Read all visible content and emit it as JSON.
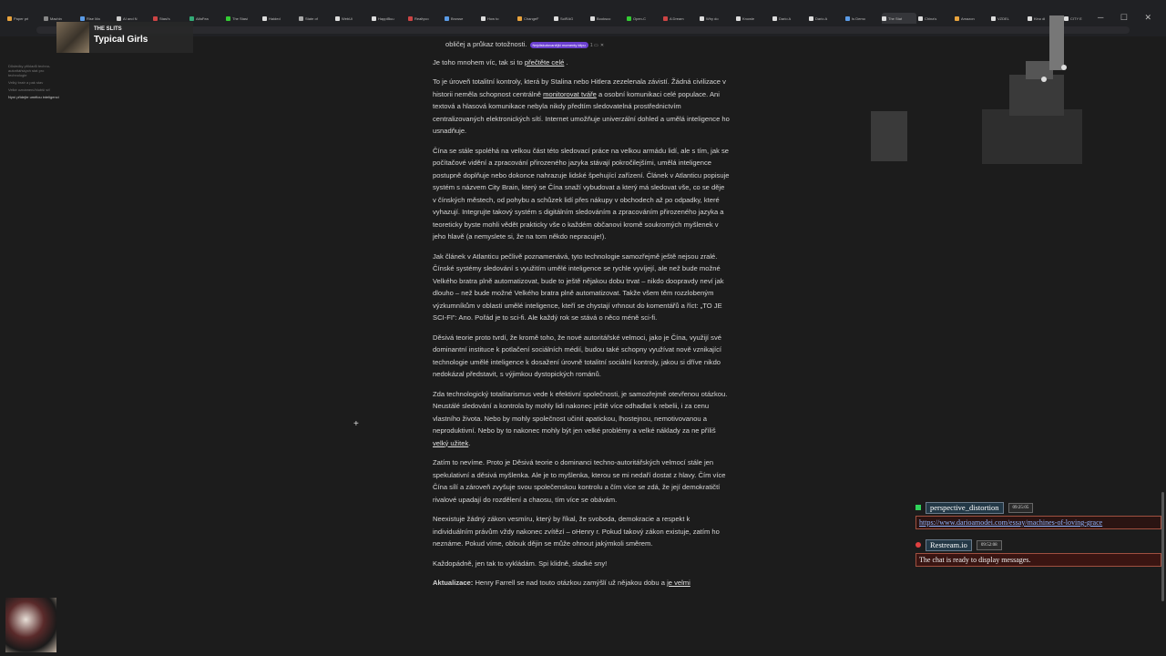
{
  "tabs": [
    {
      "label": "Paper pri",
      "color": "#e8a33d"
    },
    {
      "label": "Machin",
      "color": "#888"
    },
    {
      "label": "Rise Ma",
      "color": "#5a9be6"
    },
    {
      "label": "AI and N",
      "color": "#ccc"
    },
    {
      "label": "Stasi's ",
      "color": "#c44"
    },
    {
      "label": "AlfaFea",
      "color": "#3a7"
    },
    {
      "label": "The Stasi",
      "color": "#3c3"
    },
    {
      "label": "Haided ",
      "color": "#ddd"
    },
    {
      "label": "State of ",
      "color": "#aaa"
    },
    {
      "label": "WebUi",
      "color": "#ddd"
    },
    {
      "label": "HappiBuu",
      "color": "#ddd"
    },
    {
      "label": "Realtyvo",
      "color": "#c44"
    },
    {
      "label": "Browse",
      "color": "#5a9be6"
    },
    {
      "label": "How to ",
      "color": "#ddd"
    },
    {
      "label": "ChangeF",
      "color": "#e8a33d"
    },
    {
      "label": "SciRAG",
      "color": "#ddd"
    },
    {
      "label": "Booksco",
      "color": "#ddd"
    },
    {
      "label": "Open-C",
      "color": "#3c3"
    },
    {
      "label": "A Dream",
      "color": "#c44"
    },
    {
      "label": "Why do",
      "color": "#ddd"
    },
    {
      "label": "Knowle",
      "color": "#ddd"
    },
    {
      "label": "Dario A",
      "color": "#ddd"
    },
    {
      "label": "Dario A",
      "color": "#ddd"
    },
    {
      "label": "Is Demo",
      "color": "#5a9be6"
    },
    {
      "label": "The Stat",
      "color": "#ddd"
    },
    {
      "label": "China's",
      "color": "#ddd"
    },
    {
      "label": "Amazon",
      "color": "#e8a33d"
    },
    {
      "label": "VZDEL",
      "color": "#ddd"
    },
    {
      "label": "Kino di",
      "color": "#ddd"
    },
    {
      "label": "CITY E",
      "color": "#ddd"
    }
  ],
  "player": {
    "artist": "THE SLITS",
    "song": "Typical Girls"
  },
  "toc": [
    {
      "label": "Důsledky příkladů techno-autoritářských stat pro technologie"
    },
    {
      "label": "Velký bratr a pak stav"
    },
    {
      "label": "Velké oznámení/hlubší síť"
    },
    {
      "label": "Nyní přidejte umělou inteligenci"
    }
  ],
  "article": {
    "line0": "obličej a průkaz totožnosti.",
    "pill": "Nejdiskutovanější momenty klipu",
    "p1_pre": "Je toho mnohem víc, tak si to ",
    "p1_link": "přečtěte celé",
    "p1_post": " .",
    "p2_pre": "To je úroveň totalitní kontroly, která by Stalina nebo Hitlera zezelenala závistí. Žádná civilizace v historii neměla schopnost centrálně ",
    "p2_link": "monitorovat tváře",
    "p2_post": " a osobní komunikaci celé populace. Ani textová a hlasová komunikace nebyla nikdy předtím sledovatelná prostřednictvím centralizovaných elektronických sítí. Internet umožňuje univerzální dohled a umělá inteligence ho usnadňuje.",
    "p3": "Čína se stále spoléhá na velkou část této sledovací práce na velkou armádu lidí, ale s tím, jak se počítačové vidění a zpracování přirozeného jazyka stávají pokročilejšími, umělá inteligence postupně doplňuje nebo dokonce nahrazuje lidské špehující zařízení. Článek v Atlanticu popisuje systém s názvem City Brain, který se Čína snaží vybudovat a který má sledovat vše, co se děje v čínských městech, od pohybu a schůzek lidí přes nákupy v obchodech až po odpadky, které vyhazují. Integrujte takový systém s digitálním sledováním a zpracováním přirozeného jazyka a teoreticky byste mohli vědět prakticky vše o každém občanovi kromě soukromých myšlenek v jeho hlavě (a nemyslete si, že na tom někdo nepracuje!).",
    "p4": "Jak článek v Atlanticu pečlivě poznamenává, tyto technologie samozřejmě ještě nejsou zralé. Čínské systémy sledování s využitím umělé inteligence se rychle vyvíjejí, ale než bude možné Velkého bratra plně automatizovat, bude to ještě nějakou dobu trvat – nikdo doopravdy neví jak dlouho – než bude možné Velkého bratra plně automatizovat. Takže všem těm rozzlobeným výzkumníkům v oblasti umělé inteligence, kteří se chystají vrhnout do komentářů a říct: „TO JE SCI-FI\": Ano. Pořád je to sci-fi. Ale každý rok se stává o něco méně sci-fi.",
    "p5": "Děsivá teorie proto tvrdí, že kromě toho, že nové autoritářské velmoci, jako je Čína, využijí své dominantní instituce k potlačení sociálních médií, budou také schopny využívat nově vznikající technologie umělé inteligence k dosažení úrovně totalitní sociální kontroly, jakou si dříve nikdo nedokázal představit, s výjimkou dystopických románů.",
    "p6_pre": "Zda technologický totalitarismus vede k efektivní společnosti, je samozřejmě otevřenou otázkou. Neustálé sledování a kontrola by mohly lidi nakonec ještě více odhadlat k rebelii, i za cenu vlastního života. Nebo by mohly společnost učinit apatickou, lhostejnou, nemotivovanou a neproduktivní. Nebo by to nakonec mohly být jen velké problémy a velké náklady za ne příliš ",
    "p6_link": "velký užitek",
    "p6_post": ".",
    "p7": "Zatím to nevíme. Proto je Děsivá teorie o dominanci techno-autoritářských velmocí stále jen spekulativní a děsivá myšlenka. Ale je to myšlenka, kterou se mi nedaří dostat z hlavy. Čím více Čína sílí a zároveň zvyšuje svou společenskou kontrolu a čím více se zdá, že její demokratičtí rivalové upadají do rozdělení a chaosu, tím více se obávám.",
    "p8": "Neexistuje žádný zákon vesmíru, který by říkal, že svoboda, demokracie a respekt k individuálním právům vždy nakonec zvítězí – oHenry r. Pokud takový zákon existuje, zatím ho neznáme. Pokud víme, oblouk dějin se může ohnout jakýmkoli směrem.",
    "p9": "Každopádně, jen tak to vykládám. Spi klidně, sladké sny!",
    "p10_bold": "Aktualizace:",
    "p10_pre": " Henry Farrell se nad touto otázkou zamýšlí už nějakou dobu a ",
    "p10_link": "je velmi"
  },
  "chat": [
    {
      "user": "perspective_distortion",
      "time": "09:25:05",
      "msg": "https://www.darioamodei.com/essay/machines-of-loving-grace",
      "platform": "twitch"
    },
    {
      "user": "Restream.io",
      "time": "09:52:08",
      "msg": "The chat is ready to display messages.",
      "platform": "restream"
    }
  ],
  "colors": {
    "accent": "#6a3fd0",
    "chatLink": "#8fb4ff",
    "twitch": "#2fd35a"
  }
}
